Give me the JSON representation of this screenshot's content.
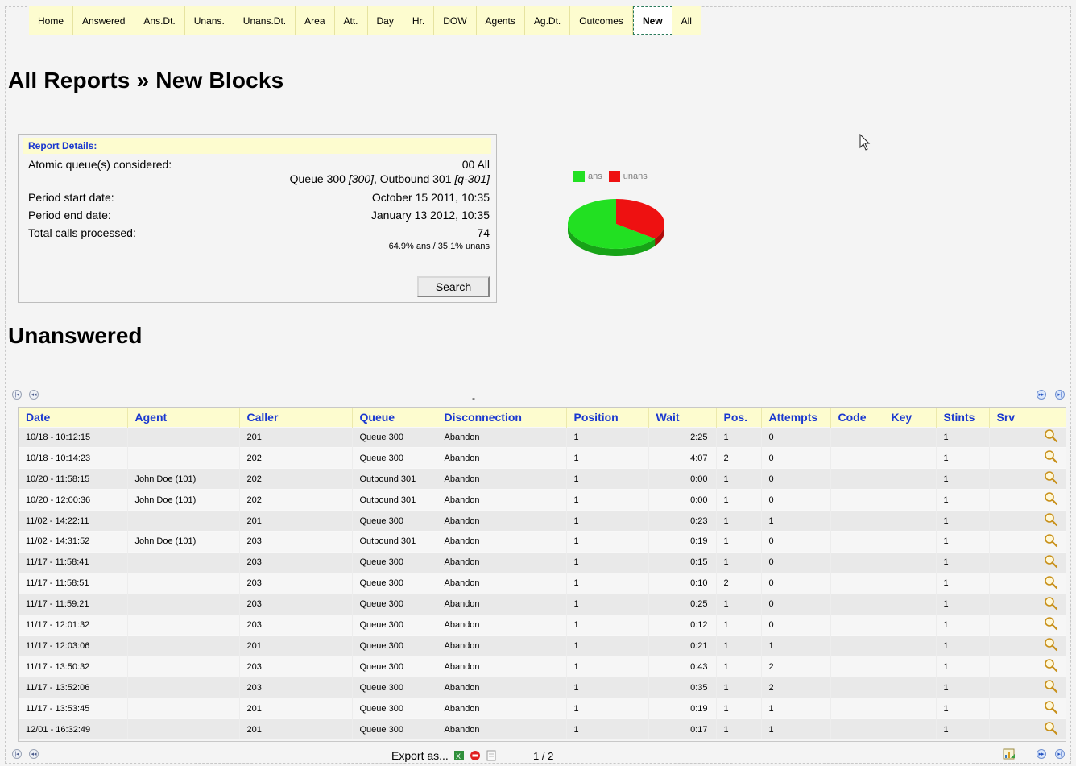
{
  "tabs": [
    {
      "label": "Home"
    },
    {
      "label": "Answered"
    },
    {
      "label": "Ans.Dt."
    },
    {
      "label": "Unans."
    },
    {
      "label": "Unans.Dt."
    },
    {
      "label": "Area"
    },
    {
      "label": "Att."
    },
    {
      "label": "Day"
    },
    {
      "label": "Hr."
    },
    {
      "label": "DOW"
    },
    {
      "label": "Agents"
    },
    {
      "label": "Ag.Dt."
    },
    {
      "label": "Outcomes"
    },
    {
      "label": "New",
      "active": true
    },
    {
      "label": "All"
    }
  ],
  "page_title": "All Reports » New Blocks",
  "report": {
    "header": "Report Details:",
    "queues_label": "Atomic queue(s) considered:",
    "queues_group": "00 All",
    "queues_q1": "Queue 300 ",
    "queues_q1_code": "[300]",
    "queues_sep": ", Outbound 301 ",
    "queues_q2_code": "[q-301]",
    "start_label": "Period start date:",
    "start_value": "October 15 2011, 10:35",
    "end_label": "Period end date:",
    "end_value": "January 13 2012, 10:35",
    "total_label": "Total calls processed:",
    "total_value": "74",
    "ratio": "64.9% ans / 35.1% unans",
    "search_label": "Search"
  },
  "pie": {
    "legend": [
      {
        "label": "ans",
        "color": "#22e022"
      },
      {
        "label": "unans",
        "color": "#ee1111"
      }
    ],
    "ans_fraction": 0.649
  },
  "section_title": "Unanswered",
  "table": {
    "columns": [
      "Date",
      "Agent",
      "Caller",
      "Queue",
      "Disconnection",
      "Position",
      "Wait",
      "Pos.",
      "Attempts",
      "Code",
      "Key",
      "Stints",
      "Srv",
      ""
    ],
    "rows": [
      [
        "10/18 - 10:12:15",
        "",
        "201",
        "Queue 300",
        "Abandon",
        "1",
        "2:25",
        "1",
        "0",
        "",
        "",
        "1",
        ""
      ],
      [
        "10/18 - 10:14:23",
        "",
        "202",
        "Queue 300",
        "Abandon",
        "1",
        "4:07",
        "2",
        "0",
        "",
        "",
        "1",
        ""
      ],
      [
        "10/20 - 11:58:15",
        "John Doe (101)",
        "202",
        "Outbound 301",
        "Abandon",
        "1",
        "0:00",
        "1",
        "0",
        "",
        "",
        "1",
        ""
      ],
      [
        "10/20 - 12:00:36",
        "John Doe (101)",
        "202",
        "Outbound 301",
        "Abandon",
        "1",
        "0:00",
        "1",
        "0",
        "",
        "",
        "1",
        ""
      ],
      [
        "11/02 - 14:22:11",
        "",
        "201",
        "Queue 300",
        "Abandon",
        "1",
        "0:23",
        "1",
        "1",
        "",
        "",
        "1",
        ""
      ],
      [
        "11/02 - 14:31:52",
        "John Doe (101)",
        "203",
        "Outbound 301",
        "Abandon",
        "1",
        "0:19",
        "1",
        "0",
        "",
        "",
        "1",
        ""
      ],
      [
        "11/17 - 11:58:41",
        "",
        "203",
        "Queue 300",
        "Abandon",
        "1",
        "0:15",
        "1",
        "0",
        "",
        "",
        "1",
        ""
      ],
      [
        "11/17 - 11:58:51",
        "",
        "203",
        "Queue 300",
        "Abandon",
        "1",
        "0:10",
        "2",
        "0",
        "",
        "",
        "1",
        ""
      ],
      [
        "11/17 - 11:59:21",
        "",
        "203",
        "Queue 300",
        "Abandon",
        "1",
        "0:25",
        "1",
        "0",
        "",
        "",
        "1",
        ""
      ],
      [
        "11/17 - 12:01:32",
        "",
        "203",
        "Queue 300",
        "Abandon",
        "1",
        "0:12",
        "1",
        "0",
        "",
        "",
        "1",
        ""
      ],
      [
        "11/17 - 12:03:06",
        "",
        "201",
        "Queue 300",
        "Abandon",
        "1",
        "0:21",
        "1",
        "1",
        "",
        "",
        "1",
        ""
      ],
      [
        "11/17 - 13:50:32",
        "",
        "203",
        "Queue 300",
        "Abandon",
        "1",
        "0:43",
        "1",
        "2",
        "",
        "",
        "1",
        ""
      ],
      [
        "11/17 - 13:52:06",
        "",
        "203",
        "Queue 300",
        "Abandon",
        "1",
        "0:35",
        "1",
        "2",
        "",
        "",
        "1",
        ""
      ],
      [
        "11/17 - 13:53:45",
        "",
        "201",
        "Queue 300",
        "Abandon",
        "1",
        "0:19",
        "1",
        "1",
        "",
        "",
        "1",
        ""
      ],
      [
        "12/01 - 16:32:49",
        "",
        "201",
        "Queue 300",
        "Abandon",
        "1",
        "0:17",
        "1",
        "1",
        "",
        "",
        "1",
        ""
      ]
    ]
  },
  "dash_text": "-",
  "footer": {
    "export_label": "Export as...",
    "pager": "1 / 2"
  },
  "colors": {
    "tab_bg": "#fdfccf",
    "header_text": "#1a38d0",
    "ans": "#22e022",
    "unans": "#ee1111"
  }
}
